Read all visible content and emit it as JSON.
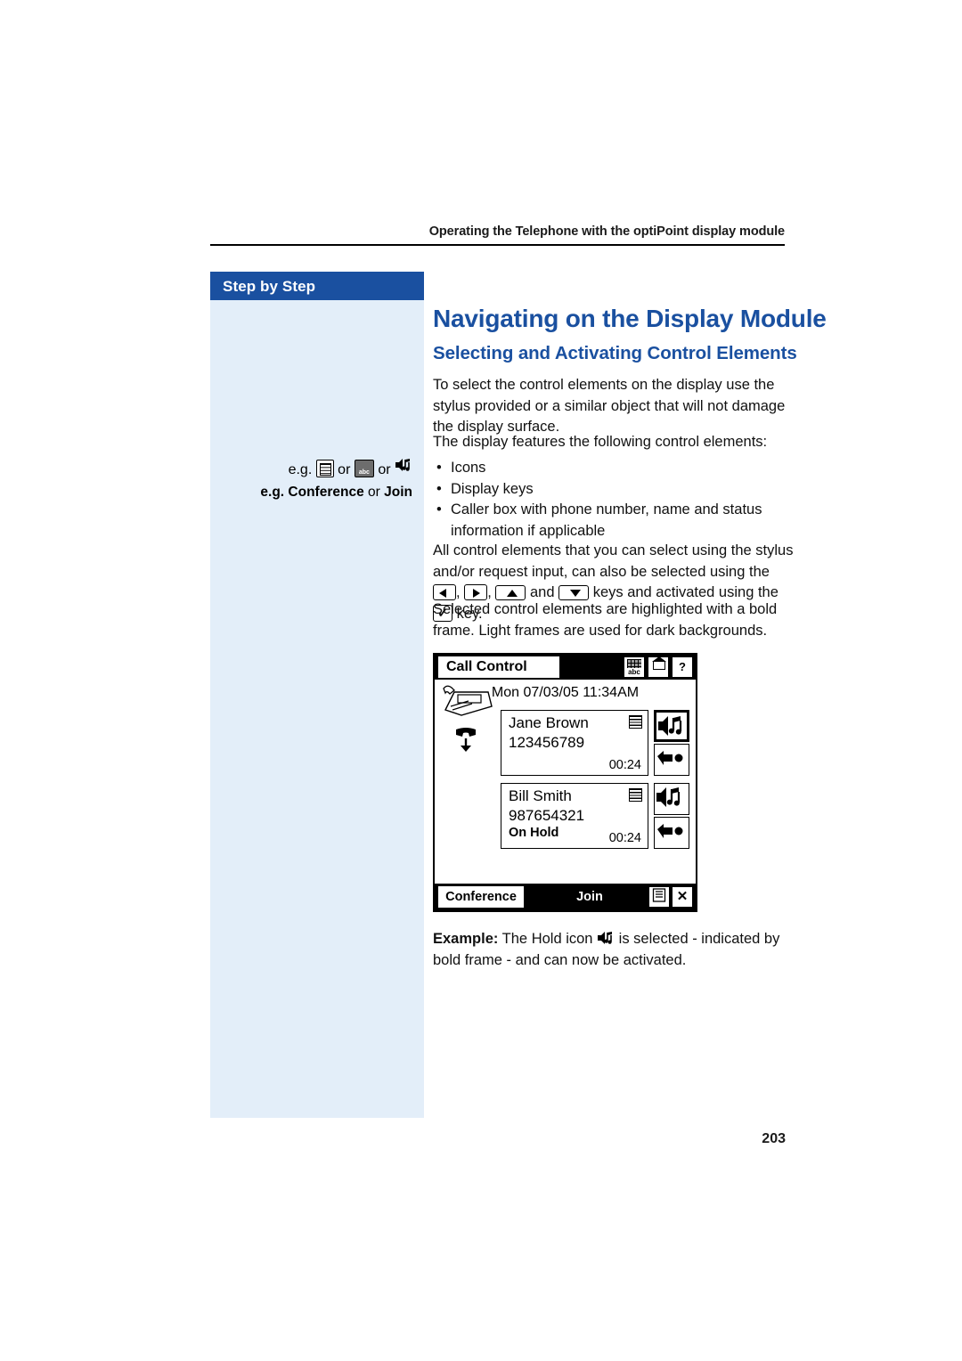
{
  "header": {
    "running_head": "Operating the Telephone with the optiPoint display module"
  },
  "sidebar": {
    "tab_label": "Step by Step",
    "example_line1_prefix": "e.g.",
    "example_line1_or1": "or",
    "example_line1_or2": "or",
    "example_line2_prefix": "e.g.",
    "example_line2_item1": "Conference",
    "example_line2_or": "or",
    "example_line2_item2": "Join",
    "icons": [
      "phonebook-key-icon",
      "keypad-abc-key-icon",
      "hold-key-icon"
    ]
  },
  "main": {
    "title": "Navigating on the Display Module",
    "subtitle": "Selecting and Activating Control Elements",
    "paragraph1": "To select the control elements on the display use the stylus provided or a similar object that will not damage the display surface.",
    "paragraph2": "The display features the following control elements:",
    "bullets": [
      "Icons",
      "Display keys",
      "Caller box with phone number, name and status information if applicable"
    ],
    "paragraph3_part1": "All control elements that you can select using the stylus and/or request input, can also be selected using the",
    "paragraph3_comma": ",",
    "paragraph3_part2": ",",
    "paragraph3_and": "and",
    "paragraph3_part3": "keys and activated using the",
    "paragraph3_part4": "key.",
    "paragraph4": "Selected control elements are highlighted with a bold frame. Light frames are used for dark backgrounds.",
    "example_label": "Example:",
    "example_text_part1": "The Hold icon",
    "example_text_part2": "is selected - indicated by bold frame - and can now be activated."
  },
  "display_module": {
    "title": "Call Control",
    "titlebar_buttons": [
      "keypad-abc-icon",
      "home-icon",
      "help-icon"
    ],
    "help_label": "?",
    "datetime": "Mon 07/03/05 11:34AM",
    "callers": [
      {
        "name": "Jane Brown",
        "number": "123456789",
        "status": "",
        "timer": "00:24",
        "keys": [
          "hold-icon",
          "transfer-icon"
        ]
      },
      {
        "name": "Bill Smith",
        "number": "987654321",
        "status": "On Hold",
        "timer": "00:24",
        "keys": [
          "hold-icon",
          "transfer-icon"
        ]
      }
    ],
    "softkeys": [
      {
        "label": "Conference",
        "name": "conference-softkey"
      },
      {
        "label": "Join",
        "name": "join-softkey"
      }
    ],
    "softkey_icons": [
      "list-icon",
      "close-icon"
    ],
    "close_label": "✕"
  },
  "footer": {
    "page_number": "203"
  }
}
